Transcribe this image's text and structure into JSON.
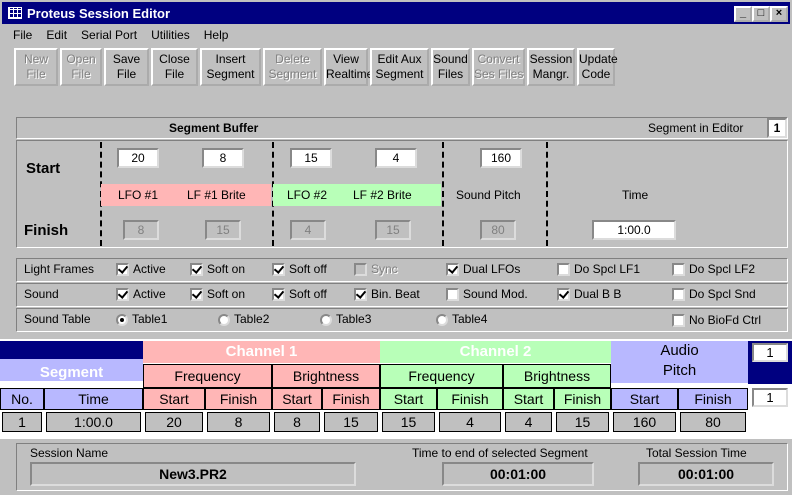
{
  "window": {
    "title": "Proteus Session Editor"
  },
  "menu": [
    "File",
    "Edit",
    "Serial Port",
    "Utilities",
    "Help"
  ],
  "toolbar": [
    {
      "label": "New\nFile",
      "enabled": false
    },
    {
      "label": "Open\nFile",
      "enabled": false
    },
    {
      "label": "Save\nFile",
      "enabled": true
    },
    {
      "label": "Close\nFile",
      "enabled": true
    },
    {
      "label": "Insert\nSegment",
      "enabled": true
    },
    {
      "label": "Delete\nSegment",
      "enabled": false
    },
    {
      "label": "View\nRealtime",
      "enabled": true
    },
    {
      "label": "Edit Aux\nSegment",
      "enabled": true
    },
    {
      "label": "Sound\nFiles",
      "enabled": true
    },
    {
      "label": "Convert\nSes Files",
      "enabled": false
    },
    {
      "label": "Session\nMangr.",
      "enabled": true
    },
    {
      "label": "Update\nCode",
      "enabled": true
    }
  ],
  "buffer": {
    "title": "Segment Buffer",
    "segment_in_editor_label": "Segment in Editor",
    "segment_in_editor_value": "1",
    "start_label": "Start",
    "finish_label": "Finish",
    "start": {
      "lfo1": "20",
      "lf1_brite": "8",
      "lfo2": "15",
      "lf2_brite": "4",
      "sound_pitch": "160"
    },
    "finish": {
      "lfo1": "8",
      "lf1_brite": "15",
      "lfo2": "4",
      "lf2_brite": "15",
      "sound_pitch": "80",
      "time": "1:00.0"
    },
    "labels": {
      "lfo1": "LFO #1",
      "lf1_brite": "LF #1 Brite",
      "lfo2": "LFO #2",
      "lf2_brite": "LF #2 Brite",
      "sound_pitch": "Sound Pitch",
      "time": "Time"
    }
  },
  "light_frames": {
    "label": "Light Frames",
    "items": [
      {
        "label": "Active",
        "checked": true,
        "enabled": true
      },
      {
        "label": "Soft on",
        "checked": true,
        "enabled": true
      },
      {
        "label": "Soft off",
        "checked": true,
        "enabled": true
      },
      {
        "label": "Sync",
        "checked": false,
        "enabled": false
      },
      {
        "label": "Dual LFOs",
        "checked": true,
        "enabled": true
      },
      {
        "label": "Do Spcl LF1",
        "checked": false,
        "enabled": true
      },
      {
        "label": "Do Spcl LF2",
        "checked": false,
        "enabled": true
      }
    ]
  },
  "sound": {
    "label": "Sound",
    "items": [
      {
        "label": "Active",
        "checked": true,
        "enabled": true
      },
      {
        "label": "Soft on",
        "checked": true,
        "enabled": true
      },
      {
        "label": "Soft off",
        "checked": true,
        "enabled": true
      },
      {
        "label": "Bin. Beat",
        "checked": true,
        "enabled": true
      },
      {
        "label": "Sound Mod.",
        "checked": false,
        "enabled": true
      },
      {
        "label": "Dual B B",
        "checked": true,
        "enabled": true
      },
      {
        "label": "Do Spcl Snd",
        "checked": false,
        "enabled": true
      }
    ]
  },
  "sound_table": {
    "label": "Sound Table",
    "options": [
      "Table1",
      "Table2",
      "Table3",
      "Table4"
    ],
    "selected": "Table1",
    "no_biofd": {
      "label": "No BioFd Ctrl",
      "checked": false
    }
  },
  "table": {
    "segment": "Segment",
    "channel1": "Channel 1",
    "channel2": "Channel 2",
    "audio_pitch": "Audio\nPitch",
    "frequency": "Frequency",
    "brightness": "Brightness",
    "no": "No.",
    "time": "Time",
    "start": "Start",
    "finish": "Finish",
    "spin_top": "1",
    "spin_bottom": "1",
    "row": [
      "1",
      "1:00.0",
      "20",
      "8",
      "8",
      "15",
      "15",
      "4",
      "4",
      "15",
      "160",
      "80"
    ]
  },
  "status": {
    "session_name_label": "Session Name",
    "session_name": "New3.PR2",
    "time_to_end_label": "Time to end of selected Segment",
    "time_to_end": "00:01:00",
    "total_time_label": "Total Session Time",
    "total_time": "00:01:00"
  },
  "colors": {
    "title": "#000080",
    "ch1": "#ffb6b6",
    "ch2": "#b8ffb8",
    "audio": "#b8b8ff",
    "segment_header": "#000080",
    "segment_sub": "#b8b8ff"
  }
}
